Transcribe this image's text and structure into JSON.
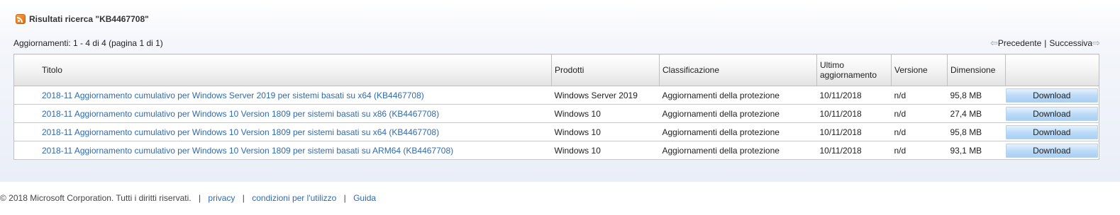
{
  "header": {
    "rss_icon": "rss-feed-icon",
    "title": "Risultati ricerca \"KB4467708\""
  },
  "summary": {
    "count_text": "Aggiornamenti: 1 - 4 di 4 (pagina 1 di 1)"
  },
  "pager": {
    "prev_label": "Precedente",
    "separator": "|",
    "next_label": "Successiva",
    "prev_icon": "arrow-left-icon",
    "next_icon": "arrow-right-icon"
  },
  "table": {
    "columns": {
      "title": "Titolo",
      "products": "Prodotti",
      "classification": "Classificazione",
      "last_updated": "Ultimo aggiornamento",
      "version": "Versione",
      "size": "Dimensione"
    },
    "rows": [
      {
        "title": "2018-11 Aggiornamento cumulativo per Windows Server 2019 per sistemi basati su x64 (KB4467708)",
        "products": "Windows Server 2019",
        "classification": "Aggiornamenti della protezione",
        "last_updated": "10/11/2018",
        "version": "n/d",
        "size": "95,8 MB",
        "action": "Download"
      },
      {
        "title": "2018-11 Aggiornamento cumulativo per Windows 10 Version 1809 per sistemi basati su x86 (KB4467708)",
        "products": "Windows 10",
        "classification": "Aggiornamenti della protezione",
        "last_updated": "10/11/2018",
        "version": "n/d",
        "size": "27,4 MB",
        "action": "Download"
      },
      {
        "title": "2018-11 Aggiornamento cumulativo per Windows 10 Version 1809 per sistemi basati su x64 (KB4467708)",
        "products": "Windows 10",
        "classification": "Aggiornamenti della protezione",
        "last_updated": "10/11/2018",
        "version": "n/d",
        "size": "95,8 MB",
        "action": "Download"
      },
      {
        "title": "2018-11 Aggiornamento cumulativo per Windows 10 Version 1809 per sistemi basati su ARM64 (KB4467708)",
        "products": "Windows 10",
        "classification": "Aggiornamenti della protezione",
        "last_updated": "10/11/2018",
        "version": "n/d",
        "size": "93,1 MB",
        "action": "Download"
      }
    ]
  },
  "footer": {
    "copyright": "© 2018 Microsoft Corporation. Tutti i diritti riservati.",
    "separator": "|",
    "privacy": "privacy",
    "terms": "condizioni per l'utilizzo",
    "help": "Guida"
  },
  "colors": {
    "link": "#2e6ab1",
    "download_button": "#bddbf7",
    "rss": "#f08a24"
  }
}
